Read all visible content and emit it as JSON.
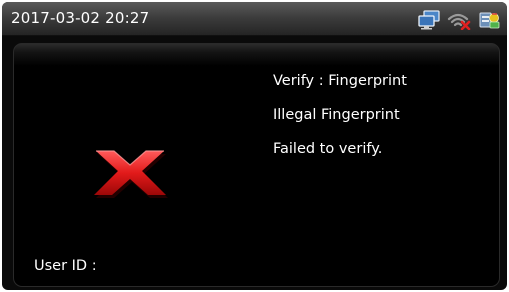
{
  "status_bar": {
    "datetime": "2017-03-02 20:27",
    "icons": [
      "network-icon",
      "wifi-disconnected-icon",
      "server-icon"
    ]
  },
  "result": {
    "icon": "fail-x-icon",
    "icon_color": "#e21a1a",
    "verify_mode": "Verify : Fingerprint",
    "reason": "Illegal Fingerprint",
    "status": "Failed to verify."
  },
  "user": {
    "id_label": "User ID :",
    "id_value": ""
  }
}
